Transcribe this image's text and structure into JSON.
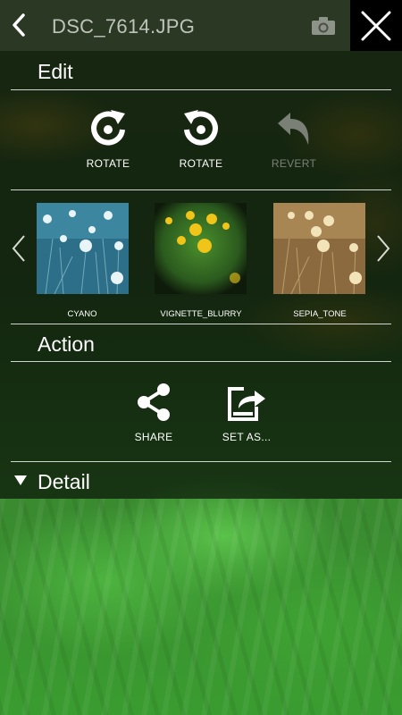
{
  "header": {
    "title": "DSC_7614.JPG"
  },
  "edit": {
    "title": "Edit",
    "buttons": [
      {
        "label": "ROTATE",
        "icon": "rotate-clockwise-icon"
      },
      {
        "label": "ROTATE",
        "icon": "rotate-counterclockwise-icon"
      },
      {
        "label": "REVERT",
        "icon": "revert-icon",
        "disabled": true
      }
    ]
  },
  "filters": [
    {
      "label": "CYANO",
      "color": "#4a8fa3"
    },
    {
      "label": "VIGNETTE_BLURRY",
      "color": "#3e7a2e"
    },
    {
      "label": "SEPIA_TONE",
      "color": "#b89a6a"
    }
  ],
  "action": {
    "title": "Action",
    "buttons": [
      {
        "label": "SHARE",
        "icon": "share-icon"
      },
      {
        "label": "SET AS...",
        "icon": "set-as-icon"
      }
    ]
  },
  "detail": {
    "title": "Detail"
  }
}
